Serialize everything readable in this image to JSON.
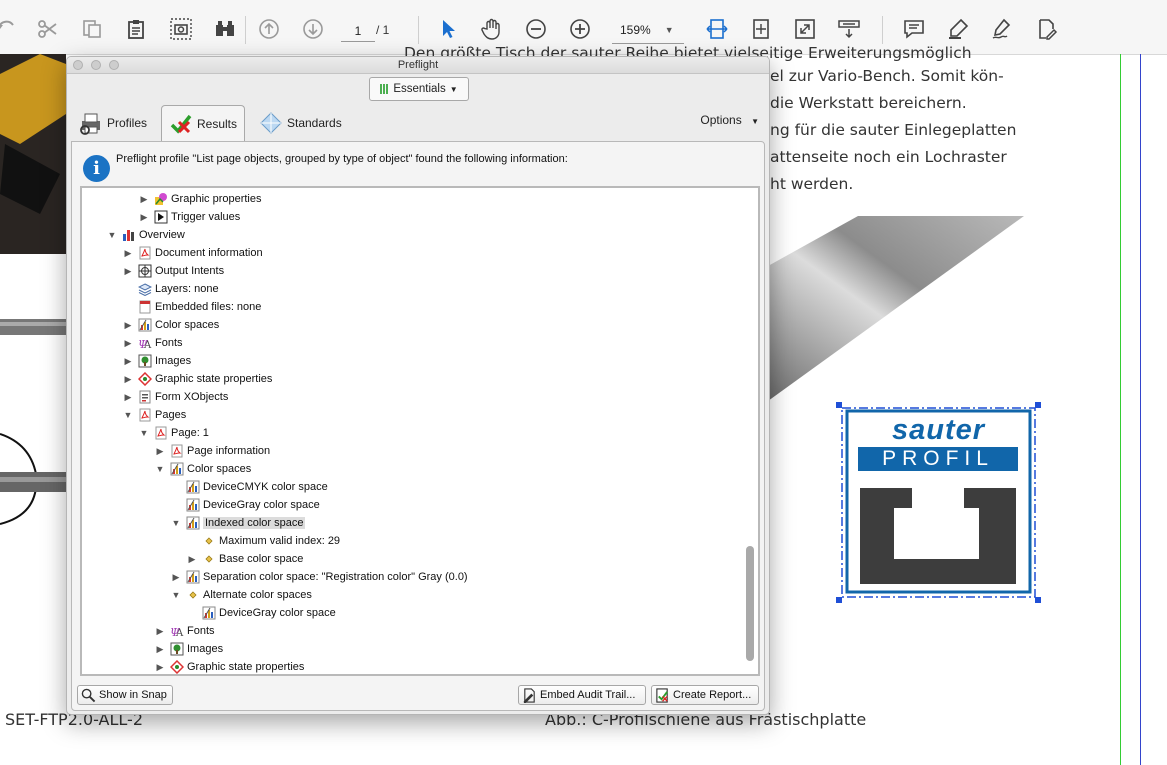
{
  "toolbar": {
    "page_current": "1",
    "page_total": "/ 1",
    "zoom": "159%"
  },
  "document": {
    "paragraph_lines": [
      "Den größte Tisch der sauter Reihe bietet vielseitige Erweiterungsmöglich",
      "el zur Vario-Bench. Somit kön-",
      "die Werkstatt bereichern.",
      "ng für die sauter Einlegeplatten",
      "attenseite noch ein Lochraster",
      "ht werden."
    ],
    "footer_left": "SET-FTP2.0-ALL-2",
    "footer_right": "Abb.: C-Profilschiene aus Frästischplatte",
    "logo_word1": "sauter",
    "logo_word2": "PROFIL",
    "logo_colors": {
      "blue": "#1166aa",
      "gray": "#3d3d3d"
    }
  },
  "preflight": {
    "title": "Preflight",
    "essentials_label": "Essentials",
    "tabs": [
      {
        "label": "Profiles"
      },
      {
        "label": "Results"
      },
      {
        "label": "Standards"
      }
    ],
    "options_label": "Options",
    "info_message": "Preflight profile \"List page objects, grouped by type of object\" found the following information:",
    "tree": [
      {
        "label": "Graphic properties",
        "level": 2,
        "toggle": "collapsed",
        "icon": "graphic-properties-icon"
      },
      {
        "label": "Trigger values",
        "level": 2,
        "toggle": "collapsed",
        "icon": "trigger-icon"
      },
      {
        "label": "Overview",
        "level": 0,
        "toggle": "expanded",
        "icon": "overview-chart-icon"
      },
      {
        "label": "Document information",
        "level": 1,
        "toggle": "collapsed",
        "icon": "pdf-icon"
      },
      {
        "label": "Output Intents",
        "level": 1,
        "toggle": "collapsed",
        "icon": "output-intent-icon"
      },
      {
        "label": "Layers: none",
        "level": 1,
        "toggle": "none",
        "icon": "layers-icon"
      },
      {
        "label": "Embedded files: none",
        "level": 1,
        "toggle": "none",
        "icon": "embedded-file-icon"
      },
      {
        "label": "Color spaces",
        "level": 1,
        "toggle": "collapsed",
        "icon": "color-space-icon"
      },
      {
        "label": "Fonts",
        "level": 1,
        "toggle": "collapsed",
        "icon": "fonts-icon"
      },
      {
        "label": "Images",
        "level": 1,
        "toggle": "collapsed",
        "icon": "image-icon"
      },
      {
        "label": "Graphic state properties",
        "level": 1,
        "toggle": "collapsed",
        "icon": "graphic-state-icon"
      },
      {
        "label": "Form XObjects",
        "level": 1,
        "toggle": "collapsed",
        "icon": "form-xobject-icon"
      },
      {
        "label": "Pages",
        "level": 1,
        "toggle": "expanded",
        "icon": "pdf-icon"
      },
      {
        "label": "Page: 1",
        "level": 2,
        "toggle": "expanded",
        "icon": "pdf-icon"
      },
      {
        "label": "Page information",
        "level": 3,
        "toggle": "collapsed",
        "icon": "pdf-icon"
      },
      {
        "label": "Color spaces",
        "level": 3,
        "toggle": "expanded",
        "icon": "color-space-icon"
      },
      {
        "label": "DeviceCMYK color space",
        "level": 4,
        "toggle": "none",
        "icon": "color-space-icon"
      },
      {
        "label": "DeviceGray color space",
        "level": 4,
        "toggle": "none",
        "icon": "color-space-icon"
      },
      {
        "label": "Indexed color space",
        "level": 4,
        "toggle": "expanded",
        "icon": "color-space-icon",
        "selected": true
      },
      {
        "label": "Maximum valid index: 29",
        "level": 5,
        "toggle": "none",
        "icon": "diamond-bullet-icon"
      },
      {
        "label": "Base color space",
        "level": 5,
        "toggle": "collapsed",
        "icon": "diamond-bullet-icon"
      },
      {
        "label": "Separation color space: \"Registration color\" Gray (0.0)",
        "level": 4,
        "toggle": "collapsed",
        "icon": "color-space-icon"
      },
      {
        "label": "Alternate color spaces",
        "level": 4,
        "toggle": "expanded",
        "icon": "diamond-bullet-icon"
      },
      {
        "label": "DeviceGray color space",
        "level": 5,
        "toggle": "none",
        "icon": "color-space-icon"
      },
      {
        "label": "Fonts",
        "level": 3,
        "toggle": "collapsed",
        "icon": "fonts-icon"
      },
      {
        "label": "Images",
        "level": 3,
        "toggle": "collapsed",
        "icon": "image-icon"
      },
      {
        "label": "Graphic state properties",
        "level": 3,
        "toggle": "collapsed",
        "icon": "graphic-state-icon"
      }
    ],
    "buttons": {
      "show_in_snap": "Show in Snap",
      "embed_audit": "Embed Audit Trail...",
      "create_report": "Create Report..."
    }
  }
}
